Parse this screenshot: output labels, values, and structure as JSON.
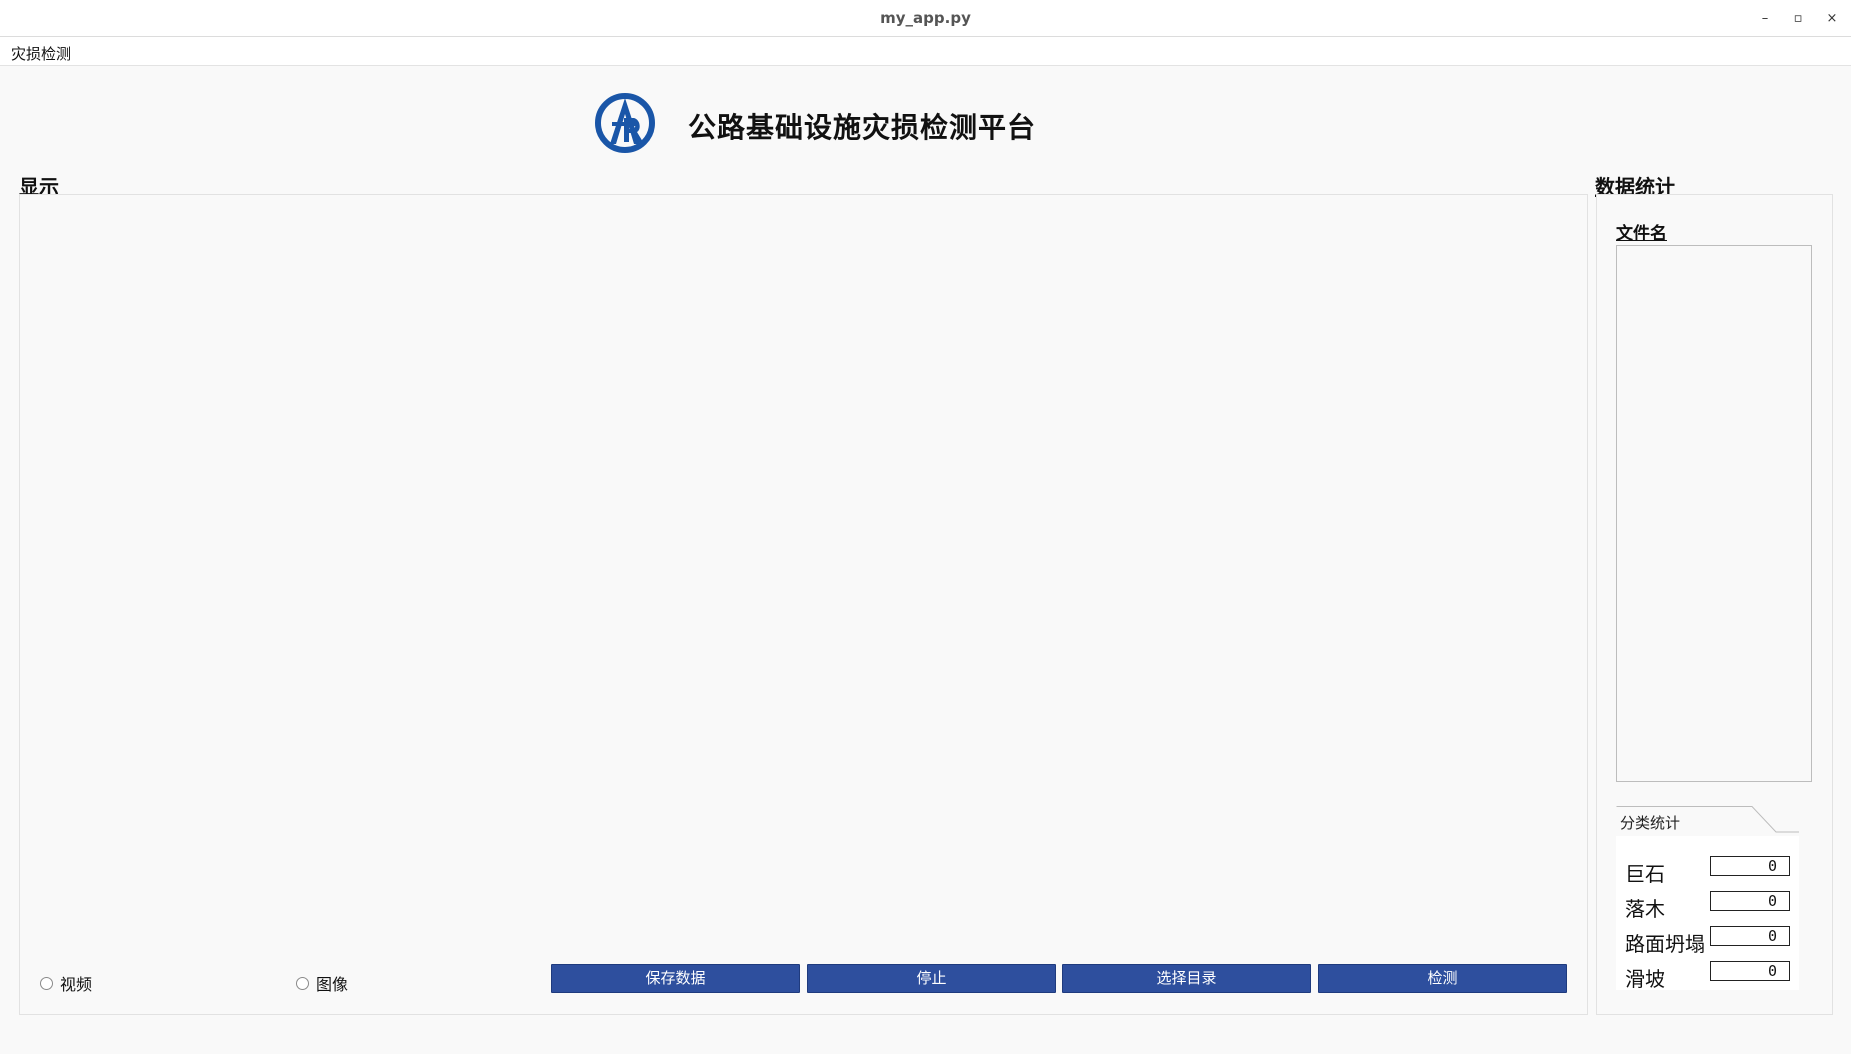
{
  "window": {
    "title": "my_app.py",
    "controls": {
      "minimize": "–",
      "restore": "▫",
      "close": "×"
    }
  },
  "menubar": {
    "items": [
      {
        "label": "灾损检测"
      }
    ]
  },
  "header": {
    "title": "公路基础设施灾损检测平台",
    "logo_color": "#1a56a8"
  },
  "display": {
    "label": "显示"
  },
  "stats": {
    "label": "数据统计",
    "filename_label": "文件名",
    "tab_label": "分类统计",
    "classes": [
      {
        "name": "巨石",
        "value": "0"
      },
      {
        "name": "落木",
        "value": "0"
      },
      {
        "name": "路面坍塌",
        "value": "0"
      },
      {
        "name": "滑坡",
        "value": "0"
      }
    ]
  },
  "controls": {
    "radio_video": "视频",
    "radio_image": "图像",
    "btn_save": "保存数据",
    "btn_stop": "停止",
    "btn_select_dir": "选择目录",
    "btn_detect": "检测",
    "button_color": "#2e4f9e"
  }
}
